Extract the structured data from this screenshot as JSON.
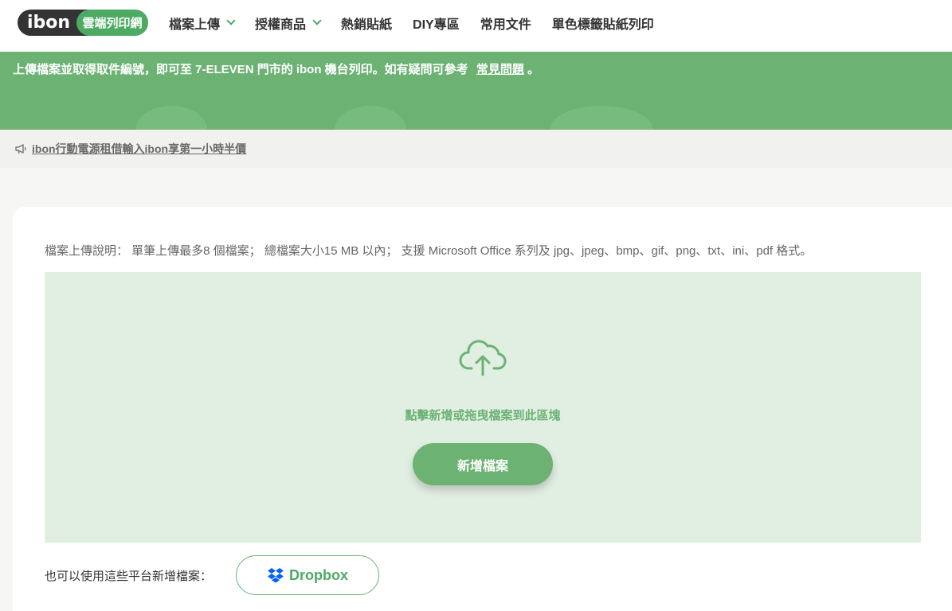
{
  "header": {
    "logo_text": "ibon",
    "logo_badge": "雲端列印網",
    "nav": [
      {
        "label": "檔案上傳",
        "has_dropdown": true
      },
      {
        "label": "授權商品",
        "has_dropdown": true
      },
      {
        "label": "熱銷貼紙",
        "has_dropdown": false
      },
      {
        "label": "DIY專區",
        "has_dropdown": false
      },
      {
        "label": "常用文件",
        "has_dropdown": false
      },
      {
        "label": "單色標籤貼紙列印",
        "has_dropdown": false
      }
    ]
  },
  "banner": {
    "text": "上傳檔案並取得取件編號，即可至 7-ELEVEN 門市的 ibon 機台列印。如有疑問可參考",
    "faq_link": "常見問題",
    "suffix": "。"
  },
  "announce": {
    "icon": "megaphone-icon",
    "link_text": "ibon行動電源租借輸入ibon享第一小時半價"
  },
  "upload": {
    "note": "檔案上傳說明： 單筆上傳最多8 個檔案； 總檔案大小15 MB 以內； 支援 Microsoft Office 系列及 jpg、jpeg、bmp、gif、png、txt、ini、pdf 格式。",
    "icon": "cloud-upload-icon",
    "drop_hint": "點擊新增或拖曳檔案到此區塊",
    "add_button": "新增檔案"
  },
  "platforms": {
    "label": "也可以使用這些平台新增檔案：",
    "dropbox_label": "Dropbox"
  },
  "colors": {
    "brand_green": "#6bb273",
    "dark": "#333333",
    "dropzone_bg": "#e1eee2"
  }
}
